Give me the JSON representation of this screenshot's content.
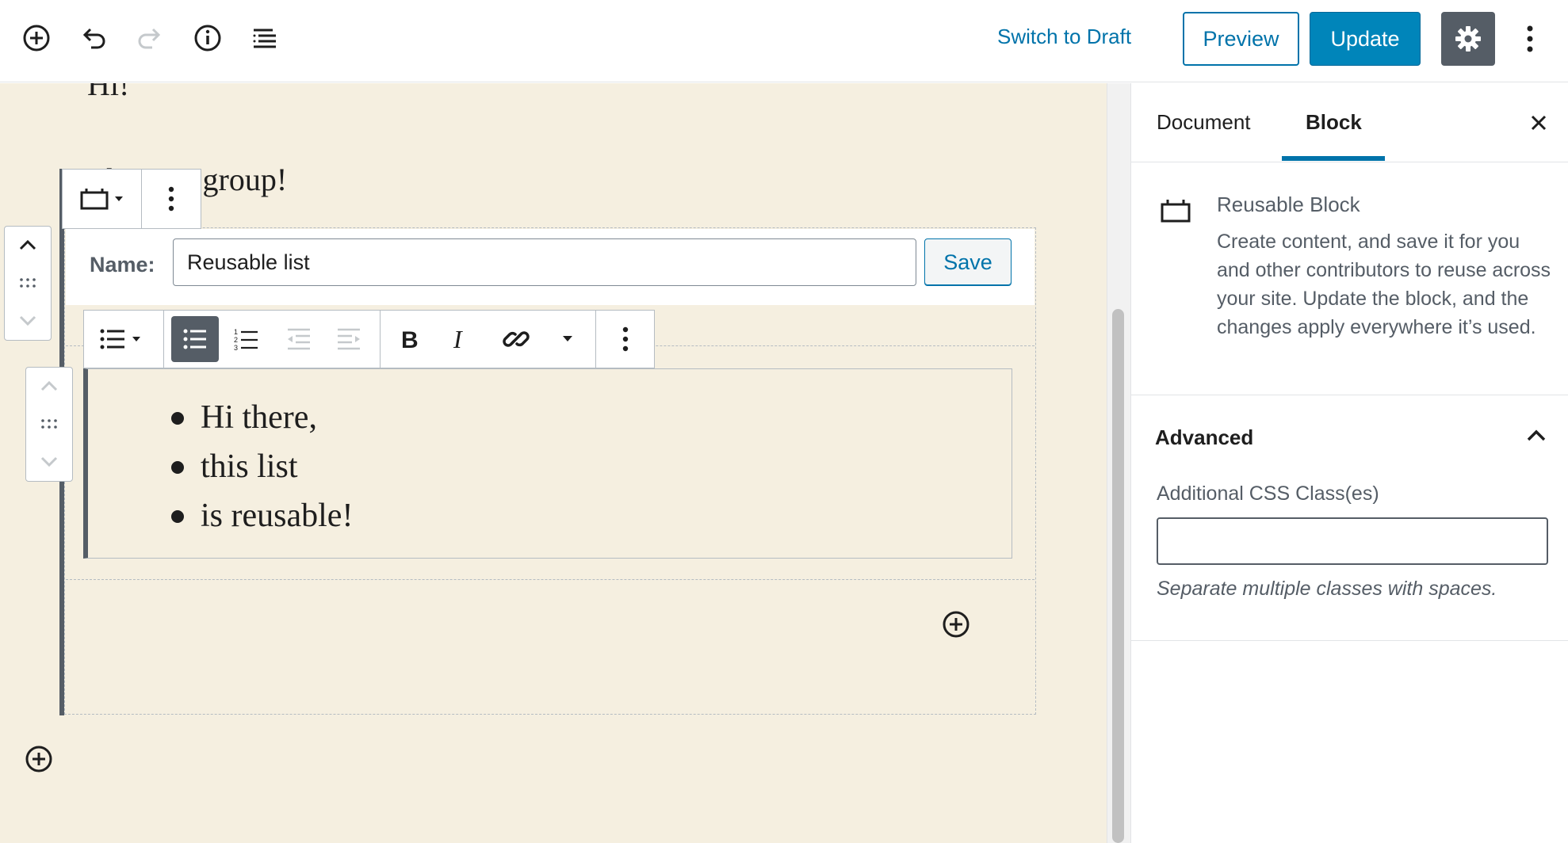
{
  "toolbar": {
    "switch_to_draft": "Switch to Draft",
    "preview": "Preview",
    "update": "Update",
    "icons": [
      "add-block-icon",
      "undo-icon",
      "redo-icon",
      "info-icon",
      "outline-icon",
      "gear-icon",
      "more-vertical-icon"
    ]
  },
  "editor": {
    "paragraph_top": "Hi!",
    "paragraph_group": "This is a group!",
    "reusable": {
      "name_label": "Name:",
      "name_value": "Reusable list",
      "save": "Save"
    },
    "list_items": [
      "Hi there,",
      "this list",
      "is reusable!"
    ]
  },
  "sidebar": {
    "tabs": [
      "Document",
      "Block"
    ],
    "active_tab": "Block",
    "block_card": {
      "title": "Reusable Block",
      "description": "Create content, and save it for you and other contributors to reuse across your site. Update the block, and the changes apply everywhere it’s used."
    },
    "advanced": {
      "title": "Advanced",
      "css_label": "Additional CSS Class(es)",
      "css_value": "",
      "css_help": "Separate multiple classes with spaces."
    }
  },
  "colors": {
    "accent": "#0073aa",
    "editor_bg": "#f5efe0",
    "dark": "#555d66"
  }
}
